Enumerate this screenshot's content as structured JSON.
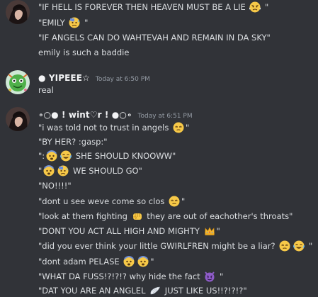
{
  "messages": [
    {
      "author": "",
      "time": "",
      "lines": [
        {
          "parts": [
            "\"IF HELL IS FOREVER THEN HEAVEN MUST BE A LIE ",
            {
              "emoji": "angry-steam-face"
            },
            " \""
          ]
        },
        {
          "parts": [
            "\"EMILY ",
            {
              "emoji": "anxious-sweat-face"
            },
            " \""
          ]
        },
        {
          "parts": [
            "\"IF ANGELS CAN DO WAHTEVAH AND REMAIN IN DA SKY\""
          ]
        },
        {
          "parts": [
            "emily is such a baddie"
          ]
        }
      ]
    },
    {
      "author": "● YIPEEE☆",
      "time": "Today at 6:50 PM",
      "lines": [
        {
          "parts": [
            "real"
          ]
        }
      ]
    },
    {
      "author": "∘○● ! wint♡r ! ●○∘",
      "time": "Today at 6:51 PM",
      "lines": [
        {
          "parts": [
            "\"i was told not to trust in angels ",
            {
              "emoji": "unamused-face"
            },
            "\""
          ]
        },
        {
          "parts": [
            "\"BY HER? :gasp:\""
          ]
        },
        {
          "parts": [
            "\":",
            {
              "emoji": "fearful-face"
            },
            {
              "emoji": "joy-face"
            },
            " SHE SHOULD KNOOWW\""
          ]
        },
        {
          "parts": [
            "\"",
            {
              "emoji": "fearful-face"
            },
            {
              "emoji": "anxious-sweat-face"
            },
            " WE SHOULD GO\""
          ]
        },
        {
          "parts": [
            "\"NO!!!!\""
          ]
        },
        {
          "parts": [
            "\"dont u see weve come so clos ",
            {
              "emoji": "unamused-face"
            },
            "\""
          ]
        },
        {
          "parts": [
            "\"look at them fighting ",
            {
              "emoji": "fist-icon"
            },
            " they are out of eachother's throats\""
          ]
        },
        {
          "parts": [
            "\"DONT YOU ACT ALL HIGH AND MIGHTY ",
            {
              "emoji": "crown-icon"
            },
            "\""
          ]
        },
        {
          "parts": [
            "\"did you ever think your little GWIRLFREN might be a liar? ",
            {
              "emoji": "unamused-face"
            },
            {
              "emoji": "joy-face"
            },
            " \""
          ]
        },
        {
          "parts": [
            "\"dont adam PELASE ",
            {
              "emoji": "fearful-face"
            },
            {
              "emoji": "fearful-face"
            },
            "\""
          ]
        },
        {
          "parts": [
            "\"WHAT DA FUSS!?!?!? why hide the fact ",
            {
              "emoji": "smiling-imp-face"
            },
            " \""
          ]
        },
        {
          "parts": [
            "\"DAT YOU ARE AN ANGLEL ",
            {
              "emoji": "wing-icon"
            },
            " JUST LIKE US!!?!?!?\""
          ]
        }
      ]
    }
  ]
}
